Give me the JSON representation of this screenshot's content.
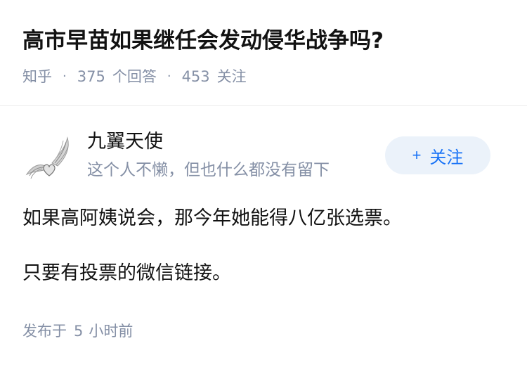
{
  "question": {
    "title": "高市早苗如果继任会发动侵华战争吗?",
    "source": "知乎",
    "answer_count": "375",
    "answer_label": "个回答",
    "follower_count": "453",
    "follower_label": "关注"
  },
  "author": {
    "name": "九翼天使",
    "bio": "这个人不懒，但也什么都没有留下",
    "avatar_icon": "winged-heart-avatar-icon",
    "follow_plus": "+",
    "follow_label": "关注"
  },
  "answer": {
    "paragraphs": [
      "如果高阿姨说会，那今年她能得八亿张选票。",
      "只要有投票的微信链接。"
    ],
    "published_prefix": "发布于",
    "published_num": "5",
    "published_unit": "小时前"
  },
  "colors": {
    "meta_gray": "#8590a6",
    "accent_blue": "#1772f6",
    "button_bg": "#ebf2fa"
  }
}
